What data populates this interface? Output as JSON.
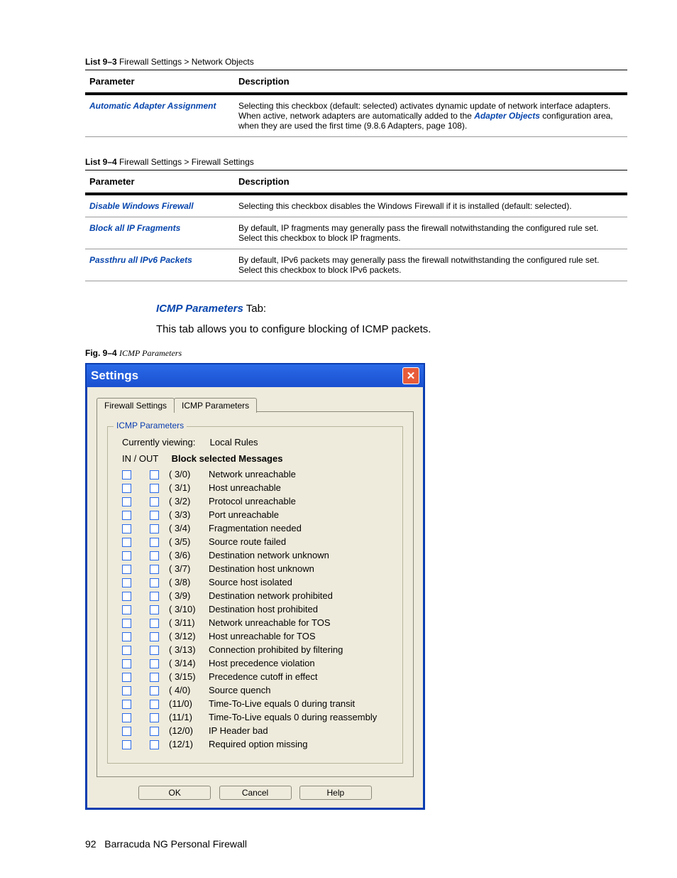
{
  "lists": [
    {
      "caption_bold": "List 9–3",
      "caption_rest": " Firewall Settings > Network Objects",
      "header_param": "Parameter",
      "header_desc": "Description",
      "rows": [
        {
          "param": "Automatic Adapter Assignment",
          "desc_pre": "Selecting this checkbox (default: selected) activates dynamic update of network interface adapters. When active, network adapters are automatically added to the ",
          "desc_link": "Adapter Objects",
          "desc_post": " configuration area, when they are used the first time (9.8.6 Adapters, page 108)."
        }
      ]
    },
    {
      "caption_bold": "List 9–4",
      "caption_rest": " Firewall Settings > Firewall Settings",
      "header_param": "Parameter",
      "header_desc": "Description",
      "rows": [
        {
          "param": "Disable Windows Firewall",
          "desc": "Selecting this checkbox disables the Windows Firewall if it is installed (default: selected)."
        },
        {
          "param": "Block all IP Fragments",
          "desc": "By default, IP fragments may generally pass the firewall notwithstanding the configured rule set. Select this checkbox to block IP fragments."
        },
        {
          "param": "Passthru all IPv6 Packets",
          "desc": "By default, IPv6 packets may generally pass the firewall notwithstanding the configured rule set. Select this checkbox to block IPv6 packets."
        }
      ]
    }
  ],
  "section": {
    "heading_em": "ICMP Parameters",
    "heading_rest": " Tab:",
    "body": "This tab allows you to configure blocking of ICMP packets."
  },
  "fig": {
    "label": "Fig. 9–4",
    "title": "ICMP Parameters"
  },
  "dialog": {
    "title": "Settings",
    "tabs": [
      "Firewall Settings",
      "ICMP Parameters"
    ],
    "active_tab": 1,
    "group_title": "ICMP Parameters",
    "cv_label": "Currently viewing:",
    "cv_value": "Local Rules",
    "col_inout": "IN / OUT",
    "col_block": "Block selected Messages",
    "messages": [
      {
        "code": "( 3/0)",
        "label": "Network unreachable"
      },
      {
        "code": "( 3/1)",
        "label": "Host unreachable"
      },
      {
        "code": "( 3/2)",
        "label": "Protocol unreachable"
      },
      {
        "code": "( 3/3)",
        "label": "Port unreachable"
      },
      {
        "code": "( 3/4)",
        "label": "Fragmentation needed"
      },
      {
        "code": "( 3/5)",
        "label": "Source route failed"
      },
      {
        "code": "( 3/6)",
        "label": "Destination network unknown"
      },
      {
        "code": "( 3/7)",
        "label": "Destination host unknown"
      },
      {
        "code": "( 3/8)",
        "label": "Source host isolated"
      },
      {
        "code": "( 3/9)",
        "label": "Destination network prohibited"
      },
      {
        "code": "( 3/10)",
        "label": "Destination host prohibited"
      },
      {
        "code": "( 3/11)",
        "label": "Network unreachable for TOS"
      },
      {
        "code": "( 3/12)",
        "label": "Host unreachable for TOS"
      },
      {
        "code": "( 3/13)",
        "label": "Connection prohibited by filtering"
      },
      {
        "code": "( 3/14)",
        "label": "Host precedence violation"
      },
      {
        "code": "( 3/15)",
        "label": "Precedence cutoff in effect"
      },
      {
        "code": "( 4/0)",
        "label": "Source quench"
      },
      {
        "code": "(11/0)",
        "label": "Time-To-Live equals 0 during transit"
      },
      {
        "code": "(11/1)",
        "label": "Time-To-Live equals 0 during reassembly"
      },
      {
        "code": "(12/0)",
        "label": "IP Header bad"
      },
      {
        "code": "(12/1)",
        "label": "Required option missing"
      }
    ],
    "buttons": {
      "ok": "OK",
      "cancel": "Cancel",
      "help": "Help"
    }
  },
  "footer": {
    "page": "92",
    "title": "Barracuda NG Personal Firewall"
  }
}
